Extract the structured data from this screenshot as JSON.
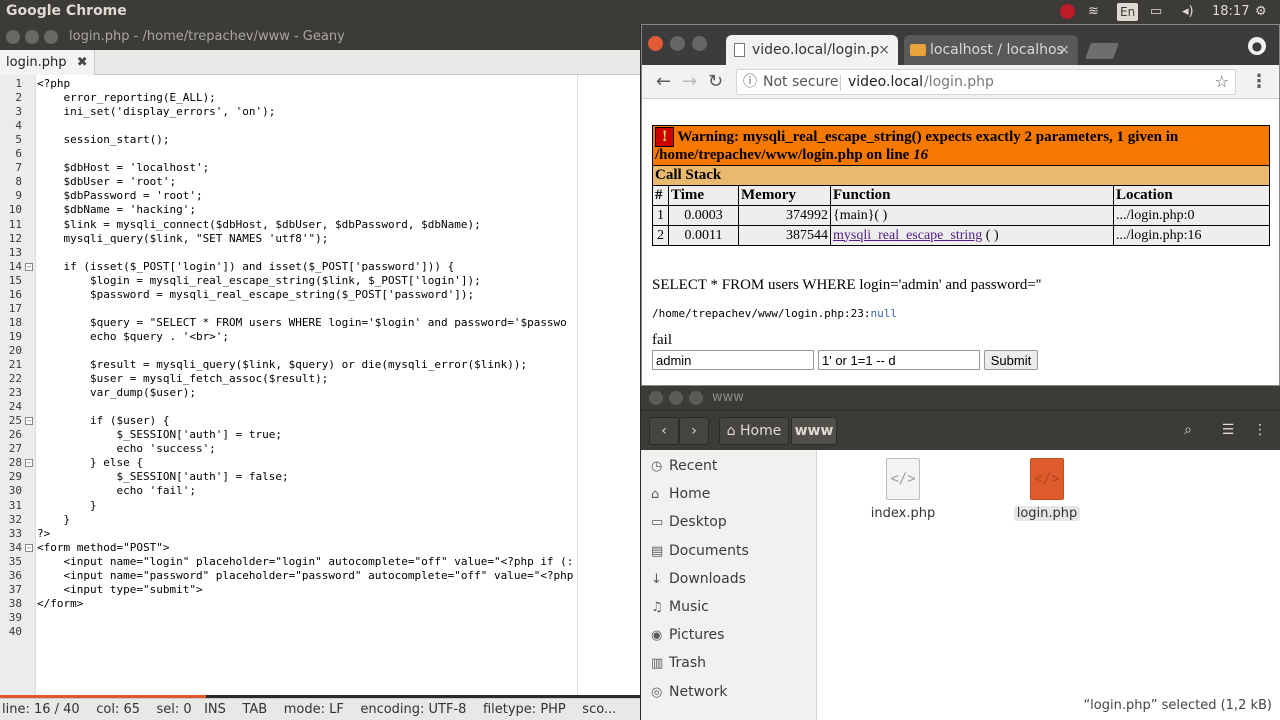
{
  "panel": {
    "app_name": "Google Chrome",
    "lang": "En",
    "time": "18:17"
  },
  "geany": {
    "title": "login.php - /home/trepachev/www - Geany",
    "tab_label": "login.php",
    "tab_close": "✖",
    "code": [
      {
        "n": "1",
        "t": "<?php"
      },
      {
        "n": "2",
        "t": "    error_reporting(E_ALL);"
      },
      {
        "n": "3",
        "t": "    ini_set('display_errors', 'on');"
      },
      {
        "n": "4",
        "t": ""
      },
      {
        "n": "5",
        "t": "    session_start();"
      },
      {
        "n": "6",
        "t": ""
      },
      {
        "n": "7",
        "t": "    $dbHost = 'localhost';"
      },
      {
        "n": "8",
        "t": "    $dbUser = 'root';"
      },
      {
        "n": "9",
        "t": "    $dbPassword = 'root';"
      },
      {
        "n": "10",
        "t": "    $dbName = 'hacking';"
      },
      {
        "n": "11",
        "t": "    $link = mysqli_connect($dbHost, $dbUser, $dbPassword, $dbName);"
      },
      {
        "n": "12",
        "t": "    mysqli_query($link, \"SET NAMES 'utf8'\");"
      },
      {
        "n": "13",
        "t": ""
      },
      {
        "n": "14",
        "t": "    if (isset($_POST['login']) and isset($_POST['password'])) {"
      },
      {
        "n": "15",
        "t": "        $login = mysqli_real_escape_string($link, $_POST['login']);"
      },
      {
        "n": "16",
        "t": "        $password = mysqli_real_escape_string($_POST['password']);"
      },
      {
        "n": "17",
        "t": ""
      },
      {
        "n": "18",
        "t": "        $query = \"SELECT * FROM users WHERE login='$login' and password='$passwo"
      },
      {
        "n": "19",
        "t": "        echo $query . '<br>';"
      },
      {
        "n": "20",
        "t": ""
      },
      {
        "n": "21",
        "t": "        $result = mysqli_query($link, $query) or die(mysqli_error($link));"
      },
      {
        "n": "22",
        "t": "        $user = mysqli_fetch_assoc($result);"
      },
      {
        "n": "23",
        "t": "        var_dump($user);"
      },
      {
        "n": "24",
        "t": ""
      },
      {
        "n": "25",
        "t": "        if ($user) {"
      },
      {
        "n": "26",
        "t": "            $_SESSION['auth'] = true;"
      },
      {
        "n": "27",
        "t": "            echo 'success';"
      },
      {
        "n": "28",
        "t": "        } else {"
      },
      {
        "n": "29",
        "t": "            $_SESSION['auth'] = false;"
      },
      {
        "n": "30",
        "t": "            echo 'fail';"
      },
      {
        "n": "31",
        "t": "        }"
      },
      {
        "n": "32",
        "t": "    }"
      },
      {
        "n": "33",
        "t": "?>"
      },
      {
        "n": "34",
        "t": "<form method=\"POST\">"
      },
      {
        "n": "35",
        "t": "    <input name=\"login\" placeholder=\"login\" autocomplete=\"off\" value=\"<?php if (:"
      },
      {
        "n": "36",
        "t": "    <input name=\"password\" placeholder=\"password\" autocomplete=\"off\" value=\"<?php"
      },
      {
        "n": "37",
        "t": "    <input type=\"submit\">"
      },
      {
        "n": "38",
        "t": "</form>"
      },
      {
        "n": "39",
        "t": ""
      },
      {
        "n": "40",
        "t": ""
      }
    ],
    "status": "line: 16 / 40    col: 65    sel: 0   INS    TAB    mode: LF    encoding: UTF-8    filetype: PHP    sco..."
  },
  "chrome": {
    "tab1": "video.local/login.p",
    "tab2": "localhost / localhos",
    "tab_close": "×",
    "not_secure": "Not secure",
    "url_host": "video.local",
    "url_path": "/login.php",
    "warning_icon": "!",
    "warning_text": "Warning: mysqli_real_escape_string() expects exactly 2 parameters, 1 given in",
    "warning_path": "/home/trepachev/www/login.php on line",
    "warning_line": "16",
    "callstack": "Call Stack",
    "cols": [
      "#",
      "Time",
      "Memory",
      "Function",
      "Location"
    ],
    "rows": [
      {
        "n": "1",
        "time": "0.0003",
        "mem": "374992",
        "fn": "{main}( )",
        "fnlink": "",
        "fnrest": "",
        "loc": ".../login.php:0"
      },
      {
        "n": "2",
        "time": "0.0011",
        "mem": "387544",
        "fn": "",
        "fnlink": "mysqli_real_escape_string",
        "fnrest": " ( )",
        "loc": ".../login.php:16"
      }
    ],
    "query_text": "SELECT * FROM users WHERE login='admin' and password=''",
    "dump_path": "/home/trepachev/www/login.php:23:",
    "dump_val": "null",
    "fail_text": "fail",
    "login_value": "admin",
    "password_value": "1' or 1=1 -- d",
    "submit_label": "Submit"
  },
  "files": {
    "title": "www",
    "home_label": "Home",
    "crumb": "www",
    "sidebar": [
      {
        "icon": "◷",
        "label": "Recent",
        "name": "recent"
      },
      {
        "icon": "⌂",
        "label": "Home",
        "name": "home"
      },
      {
        "icon": "▭",
        "label": "Desktop",
        "name": "desktop"
      },
      {
        "icon": "▤",
        "label": "Documents",
        "name": "documents"
      },
      {
        "icon": "↓",
        "label": "Downloads",
        "name": "downloads"
      },
      {
        "icon": "♫",
        "label": "Music",
        "name": "music"
      },
      {
        "icon": "◉",
        "label": "Pictures",
        "name": "pictures"
      },
      {
        "icon": "▥",
        "label": "Trash",
        "name": "trash"
      },
      {
        "icon": "◎",
        "label": "Network",
        "name": "network"
      }
    ],
    "file1": "index.php",
    "file2": "login.php",
    "status": "“login.php” selected  (1,2 kB)"
  },
  "colors": {
    "geany_status_accent": "#e2562b",
    "xdebug_warning": "#f57900",
    "xdebug_callstack": "#e9b96e",
    "php_file_icon": "#de5b2e"
  }
}
